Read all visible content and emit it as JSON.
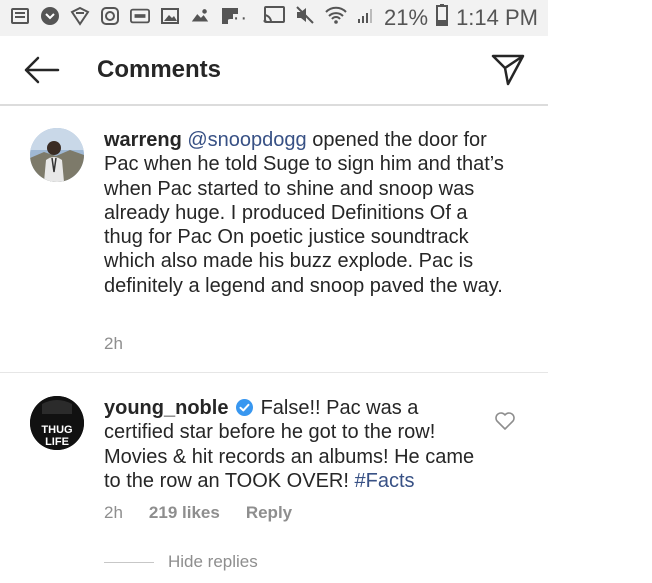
{
  "status_bar": {
    "battery": "21%",
    "time": "1:14 PM",
    "dots": "···",
    "icons": [
      "news-icon",
      "chat-icon",
      "shield-icon",
      "instagram-icon",
      "ge-icon",
      "image-icon",
      "photo-icon",
      "flipboard-icon",
      "cast-icon",
      "mute-icon",
      "wifi-icon",
      "signal-icon",
      "battery-icon"
    ]
  },
  "header": {
    "title": "Comments",
    "back_icon": "arrow-left-icon",
    "share_icon": "paper-plane-icon"
  },
  "comments": [
    {
      "username": "warreng",
      "mention": "@snoopdogg",
      "text": " opened the door for Pac when he told Suge to sign him and that’s when Pac started to shine and snoop was already huge. I produced Definitions Of a thug for Pac On poetic justice soundtrack which also made his buzz explode. Pac is definitely a legend and snoop paved the way.",
      "time": "2h"
    },
    {
      "username": "young_noble",
      "verified": true,
      "text": " False!! Pac was a certified star before he got to the row! Movies & hit records an albums! He came to the row an TOOK OVER! ",
      "hashtag": "#Facts",
      "time": "2h",
      "likes": "219 likes",
      "reply_label": "Reply",
      "avatar_text": [
        "THUG",
        "LIFE"
      ]
    }
  ],
  "hide_replies_label": "Hide replies",
  "colors": {
    "link": "#385185",
    "meta": "#8e8e8e",
    "text": "#262626",
    "verified": "#3897f0"
  }
}
